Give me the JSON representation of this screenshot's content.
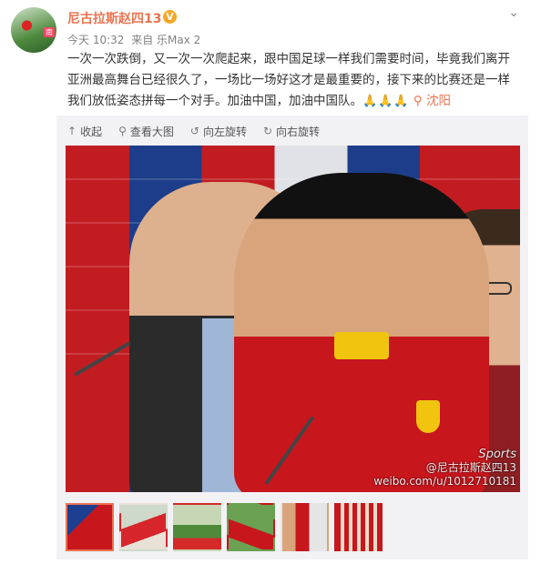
{
  "post": {
    "username": "尼古拉斯赵四13",
    "vip_badge": "V",
    "time": "今天 10:32",
    "source": "来自 乐Max 2",
    "text": "一次一次跌倒，又一次一次爬起来，跟中国足球一样我们需要时间，毕竟我们离开亚洲最高舞台已经很久了，一场比一场好这才是最重要的，接下来的比赛还是一样我们放低姿态拼每一个对手。加油中国，加油中国队。",
    "emoji": "🙏🙏🙏",
    "location": "沈阳"
  },
  "avatar": {
    "tag": "南"
  },
  "toolbar": {
    "collapse": "收起",
    "view_large": "查看大图",
    "rotate_left": "向左旋转",
    "rotate_right": "向右旋转"
  },
  "photo": {
    "watermark_logo": "Sports",
    "watermark_handle": "@尼古拉斯赵四13",
    "watermark_url": "weibo.com/u/1012710181"
  },
  "thumbnails": {
    "count": 6,
    "selected_index": 0
  },
  "colors": {
    "accent": "#eb7350",
    "text": "#333333",
    "meta": "#808080"
  }
}
